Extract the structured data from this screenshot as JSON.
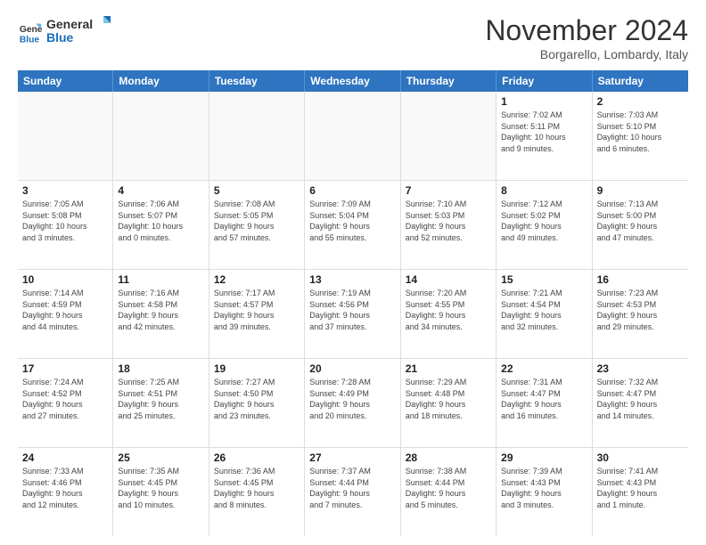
{
  "logo": {
    "line1": "General",
    "line2": "Blue"
  },
  "title": "November 2024",
  "location": "Borgarello, Lombardy, Italy",
  "header_days": [
    "Sunday",
    "Monday",
    "Tuesday",
    "Wednesday",
    "Thursday",
    "Friday",
    "Saturday"
  ],
  "rows": [
    [
      {
        "day": "",
        "info": ""
      },
      {
        "day": "",
        "info": ""
      },
      {
        "day": "",
        "info": ""
      },
      {
        "day": "",
        "info": ""
      },
      {
        "day": "",
        "info": ""
      },
      {
        "day": "1",
        "info": "Sunrise: 7:02 AM\nSunset: 5:11 PM\nDaylight: 10 hours\nand 9 minutes."
      },
      {
        "day": "2",
        "info": "Sunrise: 7:03 AM\nSunset: 5:10 PM\nDaylight: 10 hours\nand 6 minutes."
      }
    ],
    [
      {
        "day": "3",
        "info": "Sunrise: 7:05 AM\nSunset: 5:08 PM\nDaylight: 10 hours\nand 3 minutes."
      },
      {
        "day": "4",
        "info": "Sunrise: 7:06 AM\nSunset: 5:07 PM\nDaylight: 10 hours\nand 0 minutes."
      },
      {
        "day": "5",
        "info": "Sunrise: 7:08 AM\nSunset: 5:05 PM\nDaylight: 9 hours\nand 57 minutes."
      },
      {
        "day": "6",
        "info": "Sunrise: 7:09 AM\nSunset: 5:04 PM\nDaylight: 9 hours\nand 55 minutes."
      },
      {
        "day": "7",
        "info": "Sunrise: 7:10 AM\nSunset: 5:03 PM\nDaylight: 9 hours\nand 52 minutes."
      },
      {
        "day": "8",
        "info": "Sunrise: 7:12 AM\nSunset: 5:02 PM\nDaylight: 9 hours\nand 49 minutes."
      },
      {
        "day": "9",
        "info": "Sunrise: 7:13 AM\nSunset: 5:00 PM\nDaylight: 9 hours\nand 47 minutes."
      }
    ],
    [
      {
        "day": "10",
        "info": "Sunrise: 7:14 AM\nSunset: 4:59 PM\nDaylight: 9 hours\nand 44 minutes."
      },
      {
        "day": "11",
        "info": "Sunrise: 7:16 AM\nSunset: 4:58 PM\nDaylight: 9 hours\nand 42 minutes."
      },
      {
        "day": "12",
        "info": "Sunrise: 7:17 AM\nSunset: 4:57 PM\nDaylight: 9 hours\nand 39 minutes."
      },
      {
        "day": "13",
        "info": "Sunrise: 7:19 AM\nSunset: 4:56 PM\nDaylight: 9 hours\nand 37 minutes."
      },
      {
        "day": "14",
        "info": "Sunrise: 7:20 AM\nSunset: 4:55 PM\nDaylight: 9 hours\nand 34 minutes."
      },
      {
        "day": "15",
        "info": "Sunrise: 7:21 AM\nSunset: 4:54 PM\nDaylight: 9 hours\nand 32 minutes."
      },
      {
        "day": "16",
        "info": "Sunrise: 7:23 AM\nSunset: 4:53 PM\nDaylight: 9 hours\nand 29 minutes."
      }
    ],
    [
      {
        "day": "17",
        "info": "Sunrise: 7:24 AM\nSunset: 4:52 PM\nDaylight: 9 hours\nand 27 minutes."
      },
      {
        "day": "18",
        "info": "Sunrise: 7:25 AM\nSunset: 4:51 PM\nDaylight: 9 hours\nand 25 minutes."
      },
      {
        "day": "19",
        "info": "Sunrise: 7:27 AM\nSunset: 4:50 PM\nDaylight: 9 hours\nand 23 minutes."
      },
      {
        "day": "20",
        "info": "Sunrise: 7:28 AM\nSunset: 4:49 PM\nDaylight: 9 hours\nand 20 minutes."
      },
      {
        "day": "21",
        "info": "Sunrise: 7:29 AM\nSunset: 4:48 PM\nDaylight: 9 hours\nand 18 minutes."
      },
      {
        "day": "22",
        "info": "Sunrise: 7:31 AM\nSunset: 4:47 PM\nDaylight: 9 hours\nand 16 minutes."
      },
      {
        "day": "23",
        "info": "Sunrise: 7:32 AM\nSunset: 4:47 PM\nDaylight: 9 hours\nand 14 minutes."
      }
    ],
    [
      {
        "day": "24",
        "info": "Sunrise: 7:33 AM\nSunset: 4:46 PM\nDaylight: 9 hours\nand 12 minutes."
      },
      {
        "day": "25",
        "info": "Sunrise: 7:35 AM\nSunset: 4:45 PM\nDaylight: 9 hours\nand 10 minutes."
      },
      {
        "day": "26",
        "info": "Sunrise: 7:36 AM\nSunset: 4:45 PM\nDaylight: 9 hours\nand 8 minutes."
      },
      {
        "day": "27",
        "info": "Sunrise: 7:37 AM\nSunset: 4:44 PM\nDaylight: 9 hours\nand 7 minutes."
      },
      {
        "day": "28",
        "info": "Sunrise: 7:38 AM\nSunset: 4:44 PM\nDaylight: 9 hours\nand 5 minutes."
      },
      {
        "day": "29",
        "info": "Sunrise: 7:39 AM\nSunset: 4:43 PM\nDaylight: 9 hours\nand 3 minutes."
      },
      {
        "day": "30",
        "info": "Sunrise: 7:41 AM\nSunset: 4:43 PM\nDaylight: 9 hours\nand 1 minute."
      }
    ]
  ]
}
